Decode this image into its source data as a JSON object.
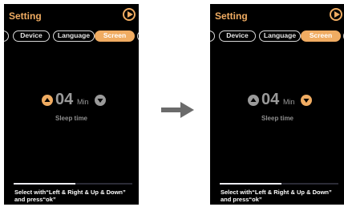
{
  "colors": {
    "accent": "#f0ac62",
    "background": "#000000",
    "dim": "#9a9a9a",
    "active_button": "#f0ac62",
    "inactive_button": "#9a9a9a"
  },
  "screens": [
    {
      "title": "Setting",
      "tabs": [
        "Device",
        "Language",
        "Screen"
      ],
      "active_tab": "Screen",
      "value": "04",
      "unit": "Min",
      "caption": "Sleep time",
      "footer_line1": "Select with“Left & Right & Up & Down”",
      "footer_line2": "and press“ok”",
      "highlighted_button": "up",
      "progress": 0.52
    },
    {
      "title": "Setting",
      "tabs": [
        "Device",
        "Language",
        "Screen"
      ],
      "active_tab": "Screen",
      "value": "04",
      "unit": "Min",
      "caption": "Sleep time",
      "footer_line1": "Select with“Left & Right & Up & Down”",
      "footer_line2": "and press“ok”",
      "highlighted_button": "down",
      "progress": 0.52
    }
  ],
  "transition_icon": "right-arrow-icon"
}
